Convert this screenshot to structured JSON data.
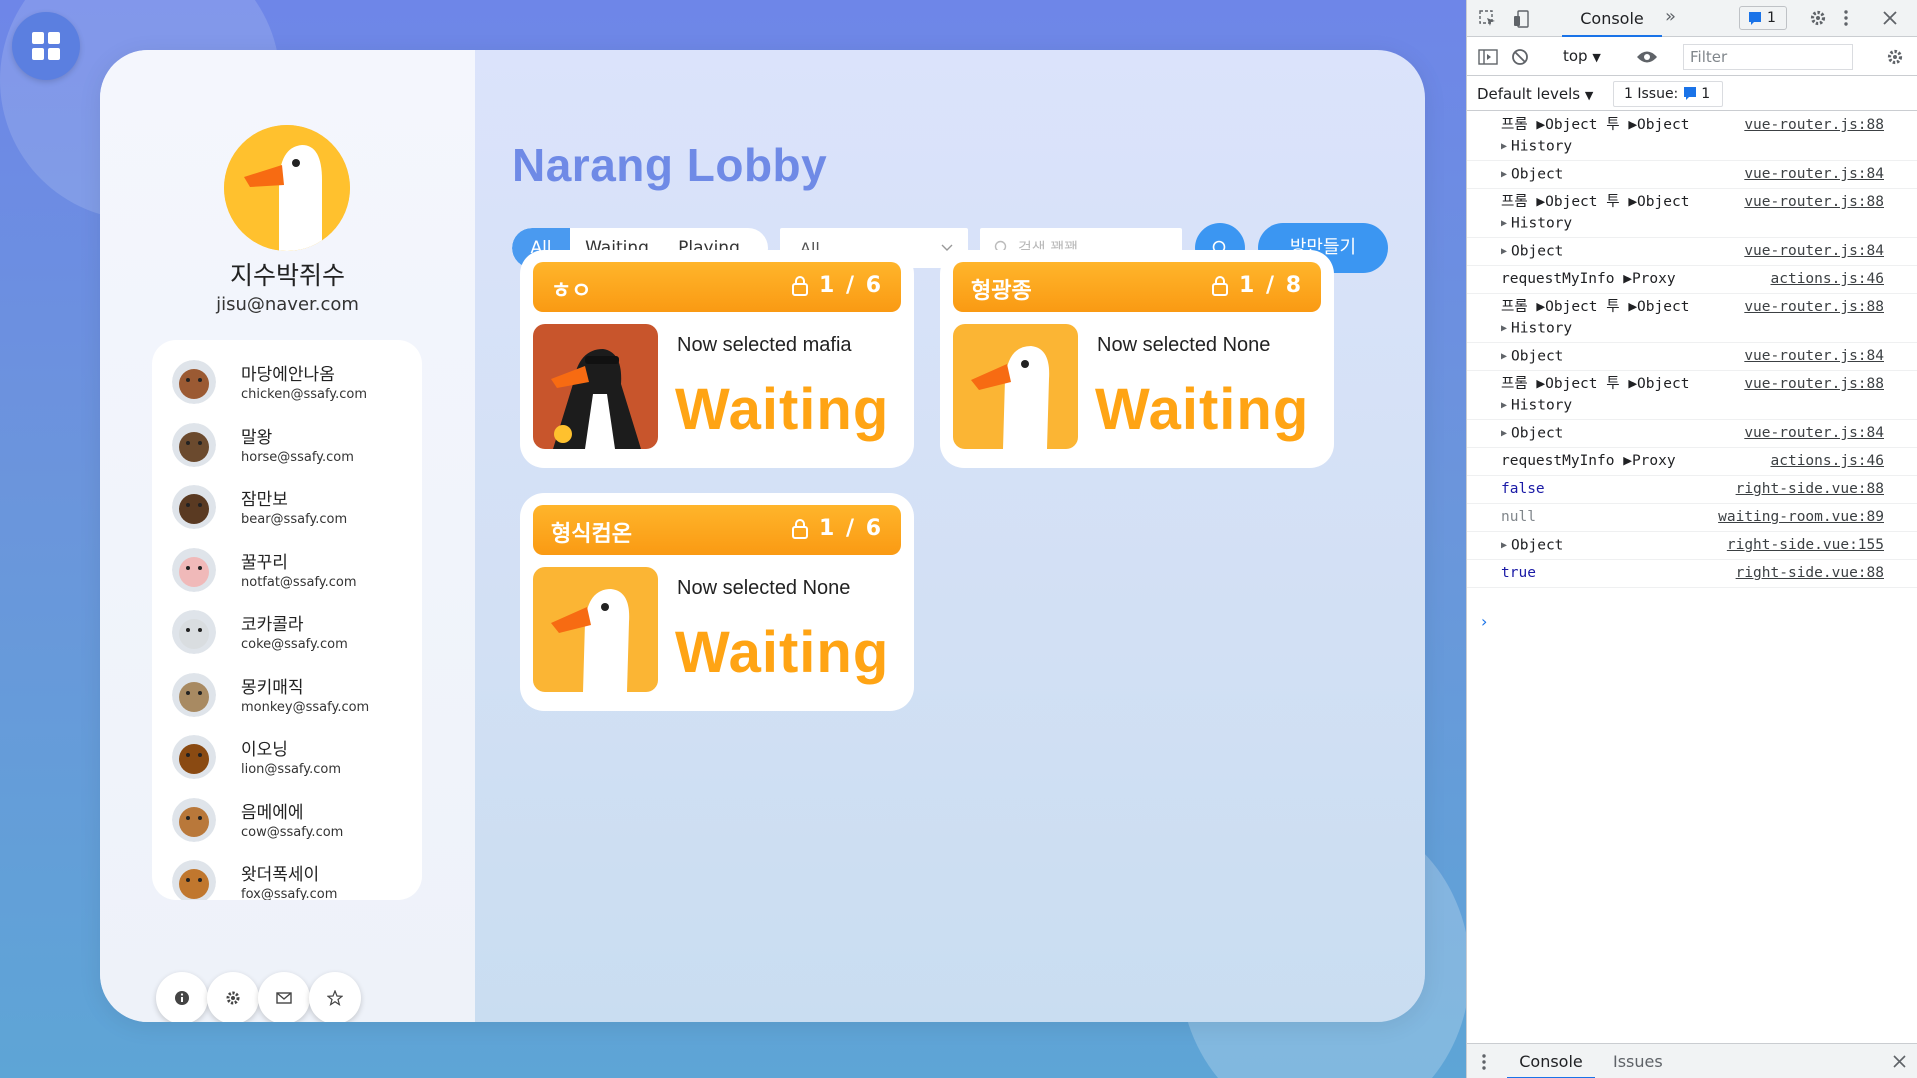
{
  "lobby": {
    "title": "Narang Lobby",
    "filters": [
      "All",
      "Waiting",
      "Playing"
    ],
    "select_value": "All",
    "search_placeholder": "검색 꽥꽥",
    "create_room_label": "방만들기"
  },
  "profile": {
    "name": "지수박쥐수",
    "email": "jisu@naver.com",
    "avatar_icon": "goose-avatar"
  },
  "friends": [
    {
      "name": "마당에안나옴",
      "email": "chicken@ssafy.com",
      "avatar": "chicken",
      "color": "#9b5a33"
    },
    {
      "name": "말왕",
      "email": "horse@ssafy.com",
      "avatar": "horse",
      "color": "#6b4a2e"
    },
    {
      "name": "잠만보",
      "email": "bear@ssafy.com",
      "avatar": "bear",
      "color": "#5a3a22"
    },
    {
      "name": "꿀꾸리",
      "email": "notfat@ssafy.com",
      "avatar": "pig",
      "color": "#f0b9b9"
    },
    {
      "name": "코카콜라",
      "email": "coke@ssafy.com",
      "avatar": "polar-bear",
      "color": "#d9dde0"
    },
    {
      "name": "몽키매직",
      "email": "monkey@ssafy.com",
      "avatar": "monkey",
      "color": "#a88a62"
    },
    {
      "name": "이오닝",
      "email": "lion@ssafy.com",
      "avatar": "lion",
      "color": "#8a4a12"
    },
    {
      "name": "음메에에",
      "email": "cow@ssafy.com",
      "avatar": "cow",
      "color": "#b9783a"
    },
    {
      "name": "왓더폭세이",
      "email": "fox@ssafy.com",
      "avatar": "fox",
      "color": "#c0772e"
    }
  ],
  "side_buttons": [
    "info-icon",
    "gear-icon",
    "mail-icon",
    "star-icon"
  ],
  "rooms": [
    {
      "name": "ㅎㅇ",
      "count": "1 / 6",
      "role": "Now selected mafia",
      "status": "Waiting",
      "thumb": "goose-mafia"
    },
    {
      "name": "형광종",
      "count": "1 / 8",
      "role": "Now selected None",
      "status": "Waiting",
      "thumb": "goose-unknown"
    },
    {
      "name": "형식컴온",
      "count": "1 / 6",
      "role": "Now selected None",
      "status": "Waiting",
      "thumb": "goose-unknown"
    }
  ],
  "colors": {
    "accent": "#3b96f2",
    "title": "#6f8ae6",
    "room_orange": "#ffa414"
  },
  "devtools": {
    "tab": "Console",
    "issues_badge": "1",
    "context": "top",
    "filter_placeholder": "Filter",
    "levels": "Default levels",
    "issue_count_label": "1 Issue:",
    "issue_count": "1",
    "drawer_console": "Console",
    "drawer_issues": "Issues",
    "logs": [
      {
        "l1": "프롬 ▶Object 투 ▶Object",
        "l2": "History",
        "src": "vue-router.js:88"
      },
      {
        "l1": "Object",
        "src": "vue-router.js:84"
      },
      {
        "l1": "프롬 ▶Object 투 ▶Object",
        "l2": "History",
        "src": "vue-router.js:88"
      },
      {
        "l1": "Object",
        "src": "vue-router.js:84"
      },
      {
        "l1": "requestMyInfo ▶Proxy",
        "src": "actions.js:46"
      },
      {
        "l1": "프롬 ▶Object 투 ▶Object",
        "l2": "History",
        "src": "vue-router.js:88"
      },
      {
        "l1": "Object",
        "src": "vue-router.js:84"
      },
      {
        "l1": "프롬 ▶Object 투 ▶Object",
        "l2": "History",
        "src": "vue-router.js:88"
      },
      {
        "l1": "Object",
        "src": "vue-router.js:84"
      },
      {
        "l1": "requestMyInfo ▶Proxy",
        "src": "actions.js:46"
      },
      {
        "l1": "false",
        "src": "right-side.vue:88"
      },
      {
        "l1": "null",
        "src": "waiting-room.vue:89"
      },
      {
        "l1": "Object",
        "src": "right-side.vue:155"
      },
      {
        "l1": "true",
        "src": "right-side.vue:88"
      }
    ]
  }
}
